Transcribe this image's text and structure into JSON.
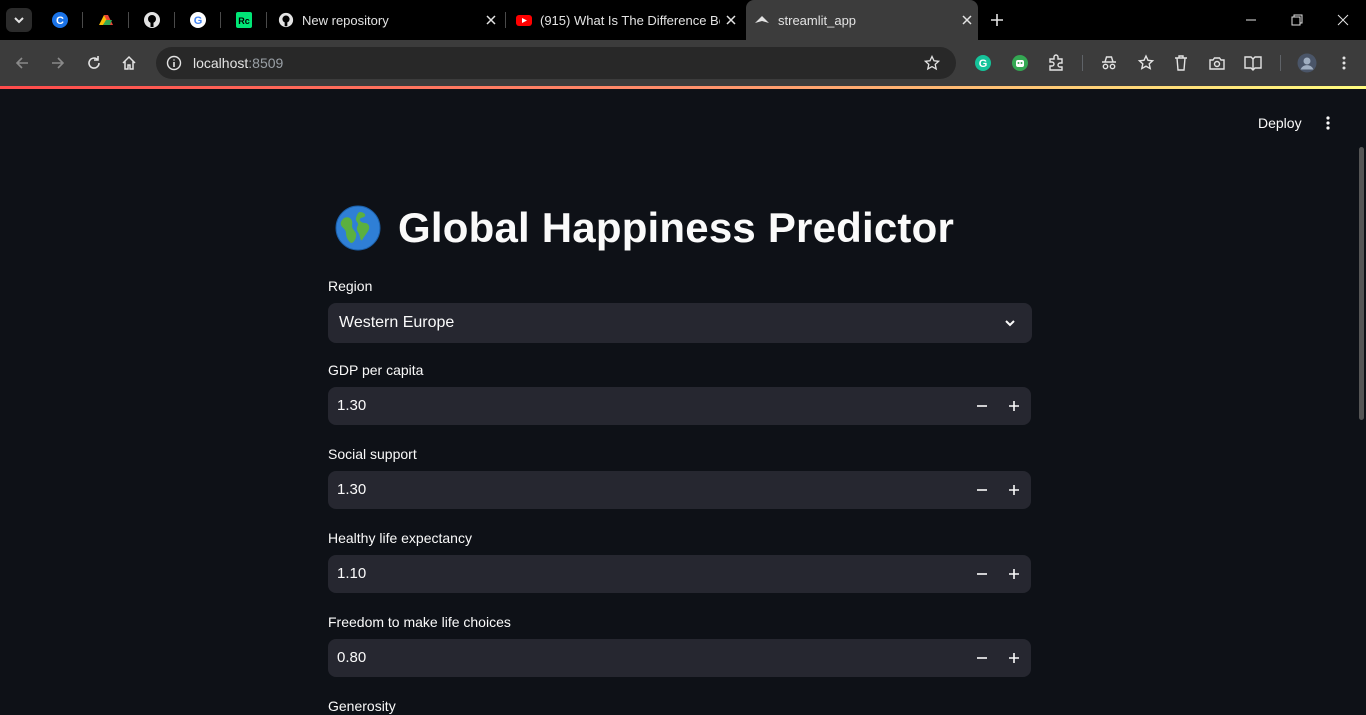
{
  "browser": {
    "tabs": [
      {
        "title": "New repository",
        "favicon": "github-icon"
      },
      {
        "title": "(915) What Is The Difference Be",
        "favicon": "youtube-icon"
      },
      {
        "title": "streamlit_app",
        "favicon": "streamlit-icon",
        "active": true
      }
    ],
    "pinned_tabs": [
      "c-icon",
      "drive-icon",
      "github-icon",
      "google-icon",
      "rc-icon"
    ],
    "url_host": "localhost",
    "url_port": ":8509"
  },
  "app": {
    "deploy_label": "Deploy",
    "title": "Global Happiness Predictor",
    "title_icon": "globe-icon",
    "fields": {
      "region": {
        "label": "Region",
        "value": "Western Europe"
      },
      "gdp": {
        "label": "GDP per capita",
        "value": "1.30"
      },
      "social": {
        "label": "Social support",
        "value": "1.30"
      },
      "life": {
        "label": "Healthy life expectancy",
        "value": "1.10"
      },
      "freedom": {
        "label": "Freedom to make life choices",
        "value": "0.80"
      },
      "generosity": {
        "label": "Generosity"
      }
    }
  },
  "colors": {
    "app_bg": "#0e1117",
    "input_bg": "#262730",
    "text": "#fafafa",
    "accent": "#ff4b4b"
  }
}
